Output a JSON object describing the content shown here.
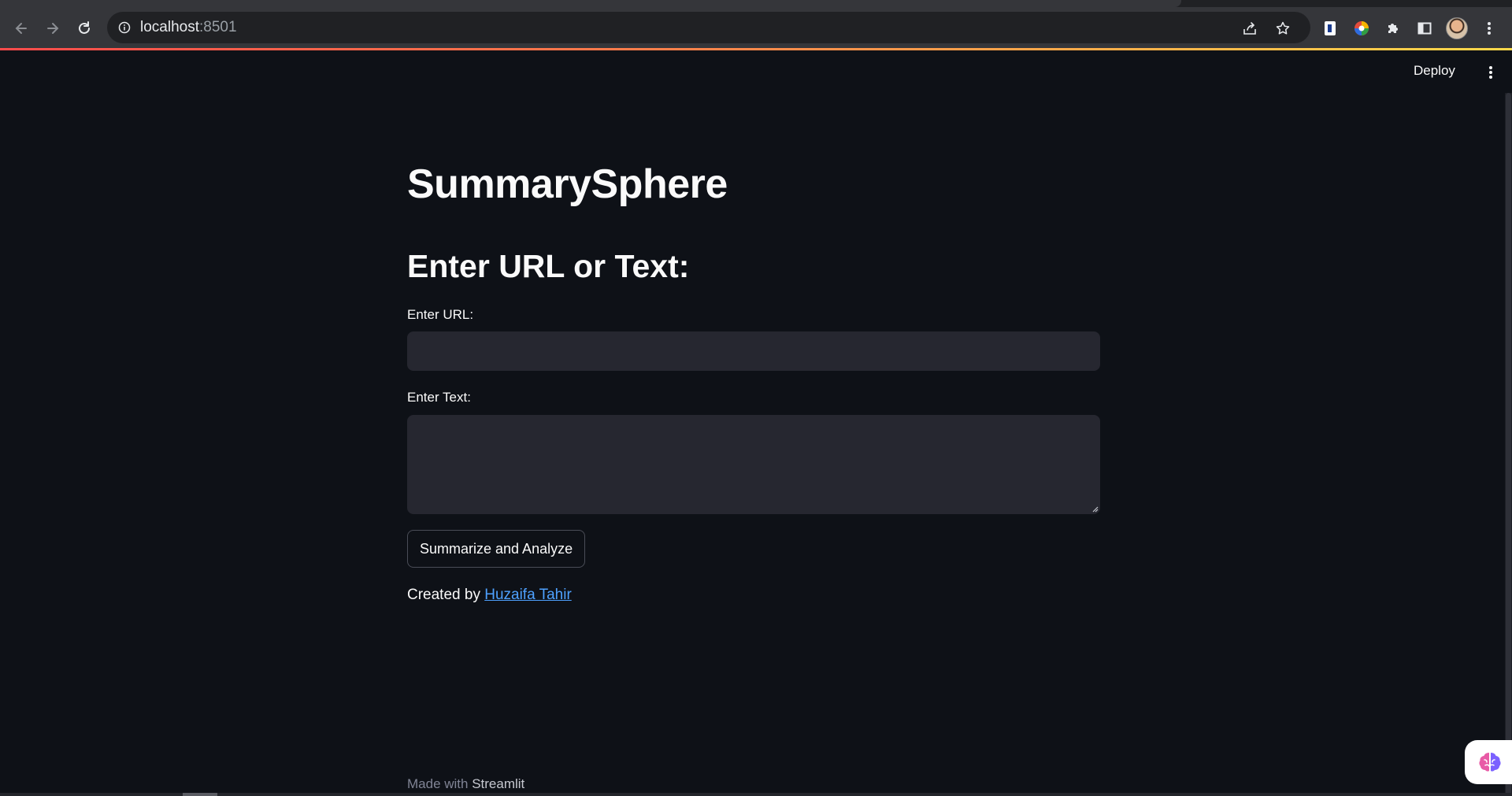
{
  "browser": {
    "address": {
      "host": "localhost",
      "port": ":8501"
    }
  },
  "app": {
    "header": {
      "deploy_label": "Deploy"
    },
    "title": "SummarySphere",
    "subtitle": "Enter URL or Text:",
    "url_field": {
      "label": "Enter URL:",
      "value": ""
    },
    "text_field": {
      "label": "Enter Text:",
      "value": ""
    },
    "submit_label": "Summarize and Analyze",
    "credit": {
      "prefix": "Created by ",
      "author": "Huzaifa Tahir"
    },
    "footer": {
      "prefix": "Made with ",
      "brand": "Streamlit"
    }
  },
  "colors": {
    "background": "#0e1117",
    "input_bg": "#262730",
    "link": "#4ea1ff",
    "accent_gradient_start": "#ff4b4b",
    "accent_gradient_end": "#fdd94a"
  },
  "icons": {
    "back": "arrow-left-icon",
    "forward": "arrow-right-icon",
    "reload": "reload-icon",
    "site_info": "info-icon",
    "share": "share-icon",
    "bookmark": "star-icon",
    "extension_1": "extension-badge-icon",
    "extension_2": "color-wheel-icon",
    "extensions": "puzzle-icon",
    "side_panel": "side-panel-icon",
    "menu": "kebab-menu-icon",
    "floating": "brain-icon"
  }
}
